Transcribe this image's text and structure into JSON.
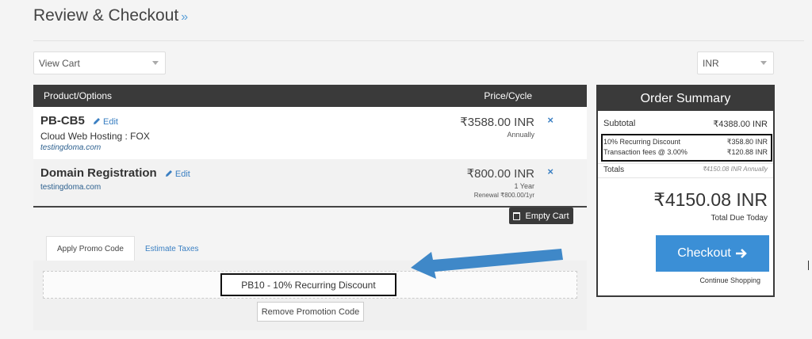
{
  "page": {
    "title": "Review & Checkout",
    "title_suffix": "»"
  },
  "controls": {
    "view_cart": "View Cart",
    "currency": "INR"
  },
  "cart": {
    "headers": {
      "product": "Product/Options",
      "price": "Price/Cycle"
    },
    "items": [
      {
        "name": "PB-CB5",
        "edit": "Edit",
        "group": "Cloud Web Hosting : FOX",
        "domain": "testingdoma.com",
        "price": "₹3588.00 INR",
        "cycle": "Annually",
        "renewal": ""
      },
      {
        "name": "Domain Registration",
        "edit": "Edit",
        "group": "",
        "domain": "testingdoma.com",
        "price": "₹800.00 INR",
        "cycle": "1 Year",
        "renewal": "Renewal ₹800.00/1yr"
      }
    ],
    "remove_glyph": "×",
    "empty_cart": "Empty Cart"
  },
  "promo": {
    "tabs": [
      "Apply Promo Code",
      "Estimate Taxes"
    ],
    "code": "PB10 - 10% Recurring Discount",
    "remove_button": "Remove Promotion Code"
  },
  "summary": {
    "title": "Order Summary",
    "subtotal_label": "Subtotal",
    "subtotal_value": "₹4388.00 INR",
    "discount_label": "10% Recurring Discount",
    "discount_value": "₹358.80 INR",
    "fee_label": "Transaction fees @ 3.00%",
    "fee_value": "₹120.88 INR",
    "totals_label": "Totals",
    "totals_value": "₹4150.08 INR Annually",
    "total_due": "₹4150.08 INR",
    "total_due_label": "Total Due Today",
    "checkout": "Checkout",
    "continue": "Continue Shopping"
  },
  "colors": {
    "accent": "#3b8fd6",
    "header_dark": "#3a3a3a",
    "link": "#3a7fc2",
    "annotation_arrow": "#3f88c8"
  }
}
